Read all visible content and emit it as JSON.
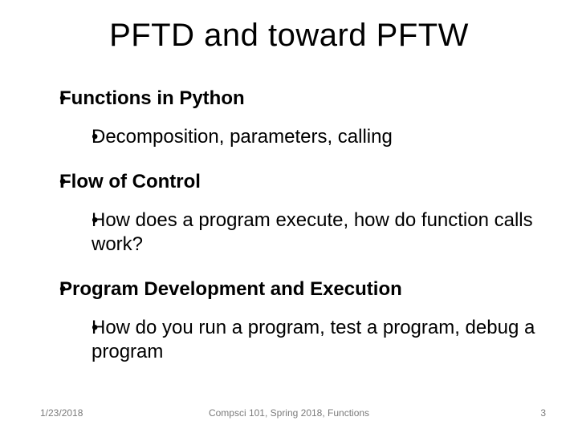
{
  "title": "PFTD and toward PFTW",
  "bullets": [
    {
      "label": "Functions in Python",
      "children": [
        "Decomposition, parameters, calling"
      ]
    },
    {
      "label": "Flow of Control",
      "children": [
        "How does a program execute, how do function calls work?"
      ]
    },
    {
      "label": "Program Development and Execution",
      "children": [
        "How do you run a program, test a program, debug a program"
      ]
    }
  ],
  "footer": {
    "date": "1/23/2018",
    "center": "Compsci 101, Spring 2018, Functions",
    "page": "3"
  }
}
